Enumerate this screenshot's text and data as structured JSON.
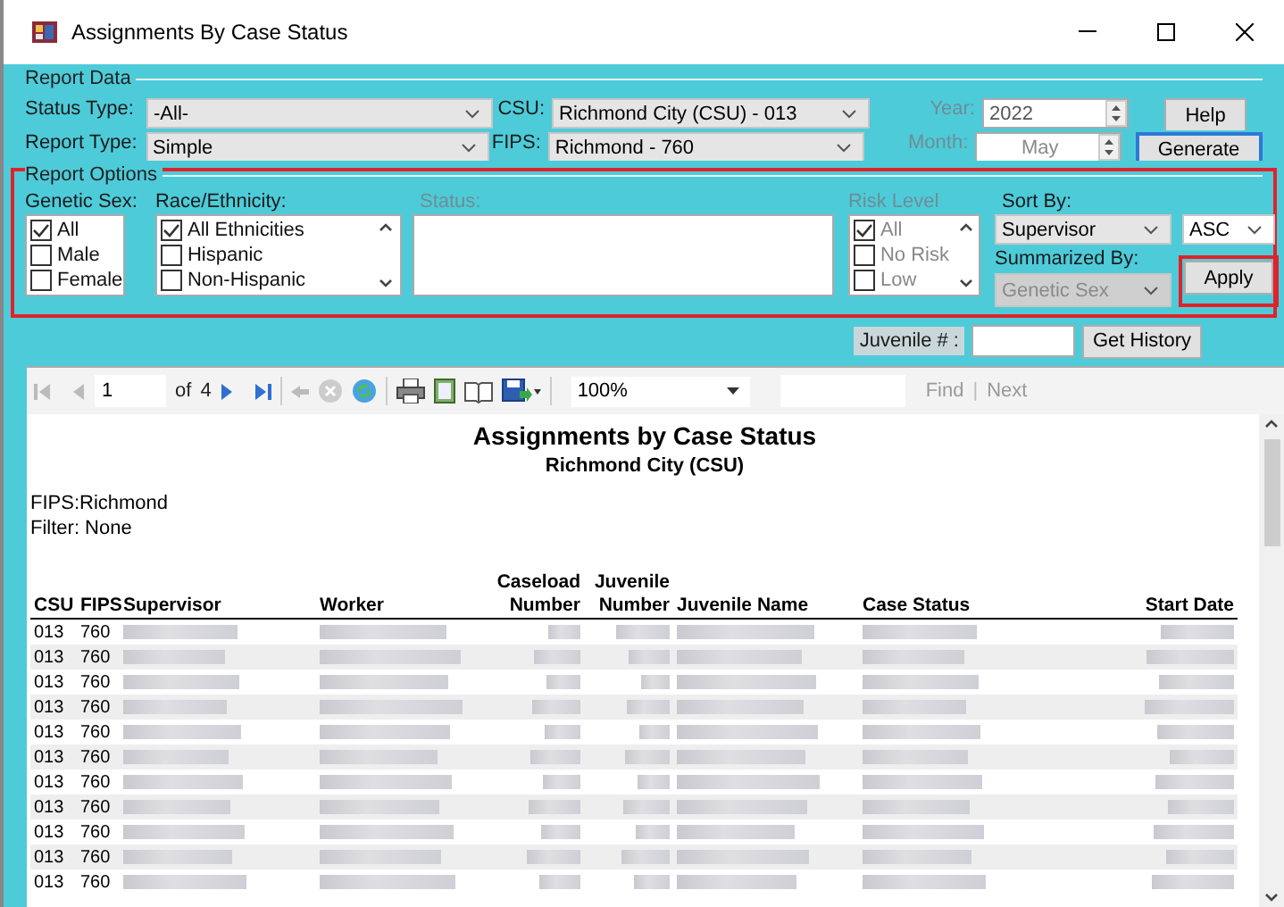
{
  "window": {
    "title": "Assignments By Case Status"
  },
  "report_data": {
    "legend": "Report Data",
    "fields": [
      {
        "label": "Status Type:",
        "value": "-All-"
      },
      {
        "label": "CSU:",
        "value": "Richmond City (CSU) - 013"
      },
      {
        "label": "Report Type:",
        "value": "Simple"
      },
      {
        "label": "FIPS:",
        "value": "Richmond - 760"
      }
    ],
    "year": {
      "label": "Year:",
      "value": "2022",
      "disabled": false
    },
    "month": {
      "label": "Month:",
      "value": "May",
      "disabled": true
    },
    "buttons": [
      {
        "label": "Help",
        "focused": false
      },
      {
        "label": "Generate",
        "focused": true
      }
    ]
  },
  "report_options": {
    "legend": "Report Options",
    "highlighted": true,
    "lists": [
      {
        "label": "Genetic Sex:",
        "disabled": false,
        "scrollable": false,
        "items": [
          {
            "label": "All",
            "checked": true
          },
          {
            "label": "Male",
            "checked": false
          },
          {
            "label": "Female",
            "checked": false
          }
        ]
      },
      {
        "label": "Race/Ethnicity:",
        "disabled": false,
        "scrollable": true,
        "items": [
          {
            "label": "All Ethnicities",
            "checked": true
          },
          {
            "label": "Hispanic",
            "checked": false
          },
          {
            "label": "Non-Hispanic",
            "checked": false
          }
        ]
      },
      {
        "label": "Status:",
        "disabled": true,
        "scrollable": false
      },
      {
        "label": "Risk Level",
        "disabled": true,
        "scrollable": true,
        "items": [
          {
            "label": "All",
            "checked": true
          },
          {
            "label": "No Risk",
            "checked": false
          },
          {
            "label": "Low",
            "checked": false
          }
        ]
      }
    ],
    "sort_by": {
      "label": "Sort By:",
      "value": "Supervisor",
      "disabled": false
    },
    "order": {
      "value": "ASC",
      "disabled": false
    },
    "summarized_by": {
      "label": "Summarized By:",
      "value": "Genetic Sex",
      "disabled": true
    },
    "apply": {
      "label": "Apply",
      "highlighted": true
    }
  },
  "juvenile": {
    "label": "Juvenile # :",
    "button": "Get History"
  },
  "toolbar": {
    "page": "1",
    "of": "of",
    "total": "4",
    "zoom": "100%",
    "find": "Find",
    "separator": "|",
    "next": "Next"
  },
  "report": {
    "title": "Assignments by Case Status",
    "subtitle": "Richmond City (CSU)",
    "fips": "FIPS:Richmond",
    "filter": "Filter: None",
    "columns": [
      {
        "bottom": "CSU"
      },
      {
        "bottom": "FIPS"
      },
      {
        "bottom": "Supervisor"
      },
      {
        "bottom": "Worker"
      },
      {
        "top": "Caseload",
        "bottom": "Number"
      },
      {
        "top": "Juvenile",
        "bottom": "Number"
      },
      {
        "bottom": "Juvenile Name"
      },
      {
        "bottom": "Case Status"
      },
      {
        "bottom": "Start Date"
      }
    ],
    "rows": [
      {
        "csu": "013",
        "fips": "760"
      },
      {
        "csu": "013",
        "fips": "760"
      },
      {
        "csu": "013",
        "fips": "760"
      },
      {
        "csu": "013",
        "fips": "760"
      },
      {
        "csu": "013",
        "fips": "760"
      },
      {
        "csu": "013",
        "fips": "760"
      },
      {
        "csu": "013",
        "fips": "760"
      },
      {
        "csu": "013",
        "fips": "760"
      },
      {
        "csu": "013",
        "fips": "760"
      },
      {
        "csu": "013",
        "fips": "760"
      },
      {
        "csu": "013",
        "fips": "760"
      }
    ]
  }
}
